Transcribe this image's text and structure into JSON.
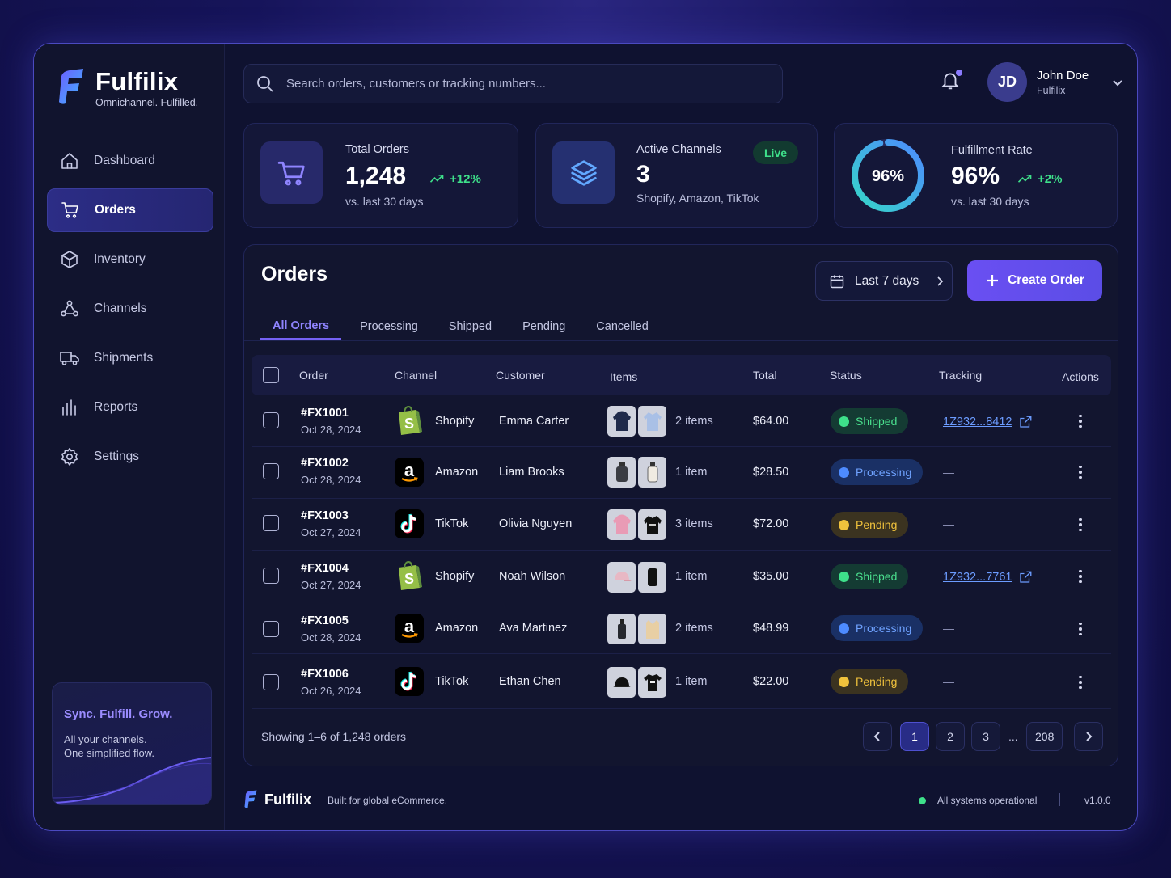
{
  "brand": {
    "name": "Fulfilix",
    "tagline": "Omnichannel. Fulfilled."
  },
  "nav": {
    "items": [
      {
        "label": "Dashboard",
        "icon": "home-icon"
      },
      {
        "label": "Orders",
        "icon": "cart-icon",
        "active": true
      },
      {
        "label": "Inventory",
        "icon": "box-icon"
      },
      {
        "label": "Channels",
        "icon": "network-icon"
      },
      {
        "label": "Shipments",
        "icon": "truck-icon"
      },
      {
        "label": "Reports",
        "icon": "bar-chart-icon"
      },
      {
        "label": "Settings",
        "icon": "gear-icon"
      }
    ]
  },
  "promo": {
    "title": "Sync. Fulfill. Grow.",
    "line1": "All your channels.",
    "line2": "One simplified flow."
  },
  "search": {
    "placeholder": "Search orders, customers or tracking numbers..."
  },
  "user": {
    "initials": "JD",
    "name": "John Doe",
    "org": "Fulfilix"
  },
  "stats": {
    "orders": {
      "label": "Total Orders",
      "value": "1,248",
      "trend": "+12%",
      "sub": "vs. last 30 days"
    },
    "channels": {
      "label": "Active Channels",
      "value": "3",
      "badge": "Live",
      "sub": "Shopify, Amazon, TikTok"
    },
    "fulfillment": {
      "label": "Fulfillment Rate",
      "value": "96%",
      "ring_label": "96%",
      "ring_fraction": 0.96,
      "trend": "+2%",
      "sub": "vs. last 30 days"
    }
  },
  "orders": {
    "title": "Orders",
    "range": "Last 7 days",
    "create_label": "Create Order",
    "tabs": [
      "All Orders",
      "Processing",
      "Shipped",
      "Pending",
      "Cancelled"
    ],
    "columns": {
      "order": "Order",
      "channel": "Channel",
      "customer": "Customer",
      "items": "Items",
      "total": "Total",
      "status": "Status",
      "tracking": "Tracking",
      "actions": "Actions"
    },
    "rows": [
      {
        "id": "#FX1001",
        "date": "Oct 28, 2024",
        "channel": "Shopify",
        "customer": "Emma Carter",
        "items": "2 items",
        "total": "$64.00",
        "status": "Shipped",
        "tracking": "1Z932...8412"
      },
      {
        "id": "#FX1002",
        "date": "Oct 28, 2024",
        "channel": "Amazon",
        "customer": "Liam Brooks",
        "items": "1 item",
        "total": "$28.50",
        "status": "Processing",
        "tracking": "—"
      },
      {
        "id": "#FX1003",
        "date": "Oct 27, 2024",
        "channel": "TikTok",
        "customer": "Olivia Nguyen",
        "items": "3 items",
        "total": "$72.00",
        "status": "Pending",
        "tracking": "—"
      },
      {
        "id": "#FX1004",
        "date": "Oct 27, 2024",
        "channel": "Shopify",
        "customer": "Noah Wilson",
        "items": "1 item",
        "total": "$35.00",
        "status": "Shipped",
        "tracking": "1Z932...7761"
      },
      {
        "id": "#FX1005",
        "date": "Oct 28, 2024",
        "channel": "Amazon",
        "customer": "Ava Martinez",
        "items": "2 items",
        "total": "$48.99",
        "status": "Processing",
        "tracking": "—"
      },
      {
        "id": "#FX1006",
        "date": "Oct 26, 2024",
        "channel": "TikTok",
        "customer": "Ethan Chen",
        "items": "1 item",
        "total": "$22.00",
        "status": "Pending",
        "tracking": "—"
      }
    ],
    "showing": "Showing 1–6 of 1,248 orders",
    "pages": [
      "1",
      "2",
      "3",
      "208"
    ],
    "ellipsis": "..."
  },
  "footer": {
    "brand": "Fulfilix",
    "built": "Built for global eCommerce.",
    "status": "All systems operational",
    "version": "v1.0.0"
  },
  "colors": {
    "accent": "#6a4ff2",
    "success": "#3ee08a",
    "info": "#4d8bff",
    "warning": "#f0c23c"
  }
}
